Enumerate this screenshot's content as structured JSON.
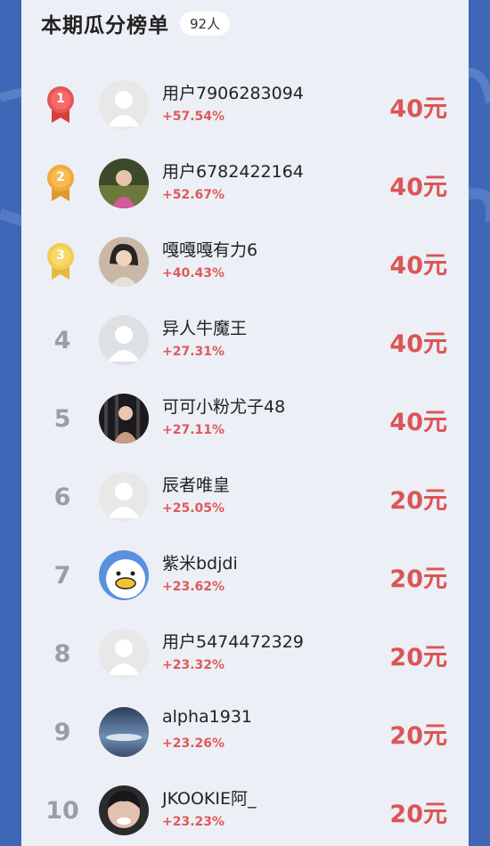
{
  "header": {
    "title": "本期瓜分榜单",
    "count": "92人"
  },
  "colors": {
    "page_bg": "#3e67b8",
    "panel_bg": "#eceff6",
    "prize_red": "#dc5555",
    "pct_red": "#dd5b5b",
    "medal_gold": "#f2a93b",
    "medal_red": "#ec5353",
    "medal_light_gold": "#f2cd52"
  },
  "rows": [
    {
      "rank": "1",
      "name": "用户7906283094",
      "pct": "+57.54%",
      "prize": "40元",
      "avatar": "default-avatar-icon"
    },
    {
      "rank": "2",
      "name": "用户6782422164",
      "pct": "+52.67%",
      "prize": "40元",
      "avatar": "user-photo-avatar"
    },
    {
      "rank": "3",
      "name": "嘎嘎嘎有力6",
      "pct": "+40.43%",
      "prize": "40元",
      "avatar": "user-photo-avatar"
    },
    {
      "rank": "4",
      "name": "异人牛魔王",
      "pct": "+27.31%",
      "prize": "40元",
      "avatar": "default-avatar-icon"
    },
    {
      "rank": "5",
      "name": "可可小粉尤子48",
      "pct": "+27.11%",
      "prize": "40元",
      "avatar": "user-photo-avatar"
    },
    {
      "rank": "6",
      "name": "辰者唯皇",
      "pct": "+25.05%",
      "prize": "20元",
      "avatar": "default-avatar-icon"
    },
    {
      "rank": "7",
      "name": "紫米bdjdi",
      "pct": "+23.62%",
      "prize": "20元",
      "avatar": "duck-cartoon-avatar"
    },
    {
      "rank": "8",
      "name": "用户5474472329",
      "pct": "+23.32%",
      "prize": "20元",
      "avatar": "default-avatar-icon"
    },
    {
      "rank": "9",
      "name": "alpha1931",
      "pct": "+23.26%",
      "prize": "20元",
      "avatar": "sky-photo-avatar"
    },
    {
      "rank": "10",
      "name": "JKOOKIE阿_",
      "pct": "+23.23%",
      "prize": "20元",
      "avatar": "user-photo-avatar"
    }
  ]
}
